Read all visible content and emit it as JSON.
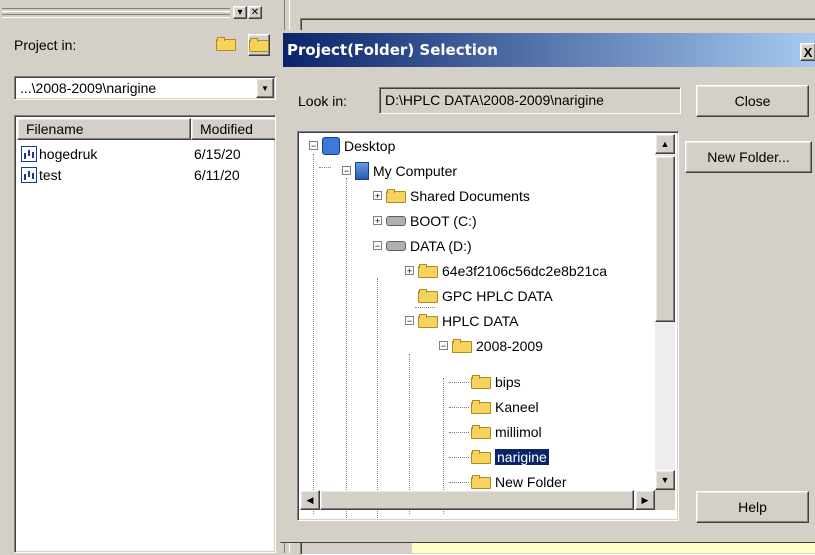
{
  "left_panel": {
    "project_label": "Project in:",
    "project_path": "...\\2008-2009\\narigine",
    "columns": [
      "Filename",
      "Modified"
    ],
    "files": [
      {
        "name": "hogedruk",
        "date": "6/15/20"
      },
      {
        "name": "test",
        "date": "6/11/20"
      }
    ]
  },
  "dialog": {
    "title": "Project(Folder) Selection",
    "close_glyph": "X",
    "look_in_label": "Look in:",
    "look_in_value": "D:\\HPLC DATA\\2008-2009\\narigine",
    "buttons": {
      "close": "Close",
      "new_folder": "New Folder...",
      "help": "Help"
    },
    "tree": [
      {
        "label": "Desktop",
        "icon": "desktop-icon"
      },
      {
        "label": "My Computer",
        "icon": "computer-icon"
      },
      {
        "label": "Shared Documents",
        "icon": "folder-icon"
      },
      {
        "label": "BOOT (C:)",
        "icon": "drive-icon"
      },
      {
        "label": "DATA (D:)",
        "icon": "drive-icon"
      },
      {
        "label": "64e3f2106c56dc2e8b21ca",
        "icon": "folder-icon"
      },
      {
        "label": "GPC HPLC DATA",
        "icon": "folder-icon"
      },
      {
        "label": "HPLC DATA",
        "icon": "folder-icon"
      },
      {
        "label": "2008-2009",
        "icon": "folder-icon"
      },
      {
        "label": "bips",
        "icon": "folder-icon"
      },
      {
        "label": "Kaneel",
        "icon": "folder-icon"
      },
      {
        "label": "millimol",
        "icon": "folder-icon"
      },
      {
        "label": "narigine",
        "icon": "folder-icon",
        "selected": true
      },
      {
        "label": "New Folder",
        "icon": "folder-icon"
      }
    ]
  },
  "colors": {
    "titlebar_start": "#0a246a",
    "titlebar_end": "#a6caf0",
    "selection": "#0a246a",
    "face": "#d4d0c8"
  }
}
